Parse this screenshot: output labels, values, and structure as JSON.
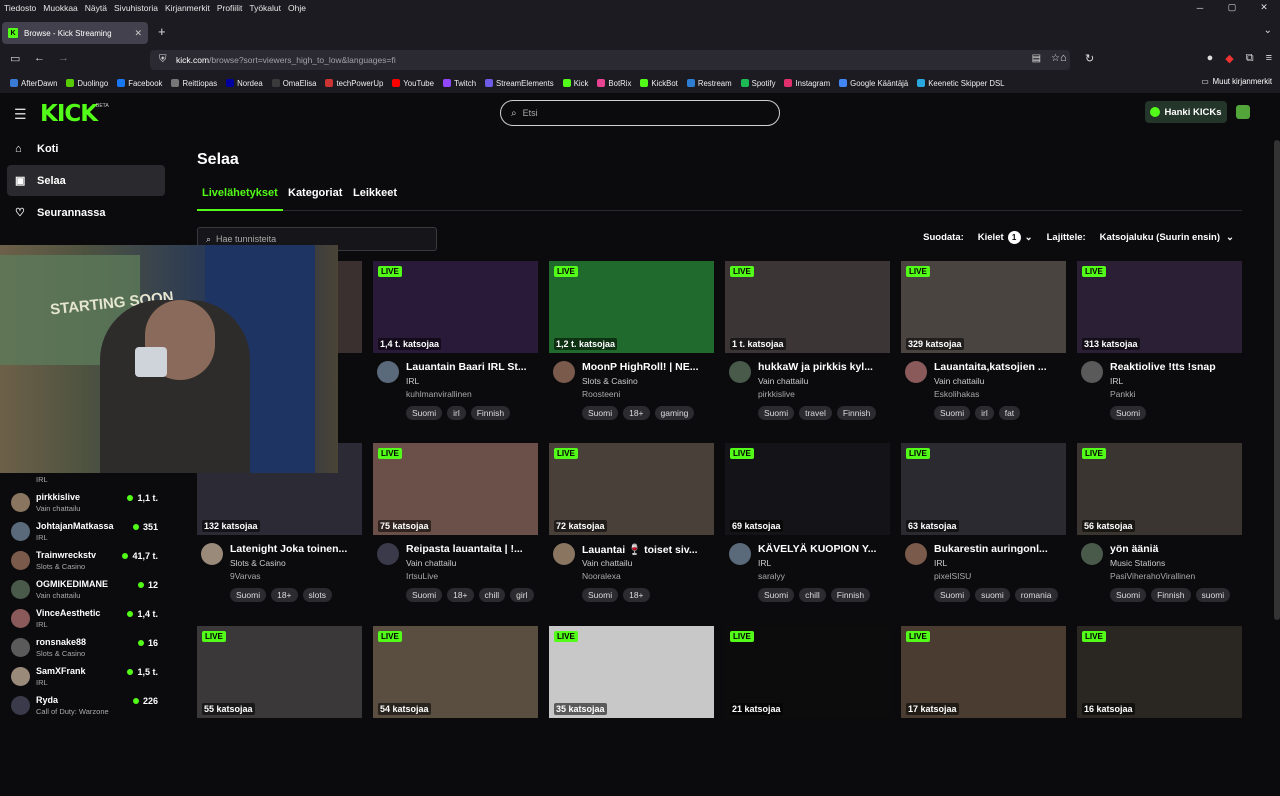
{
  "menubar": [
    "Tiedosto",
    "Muokkaa",
    "Näytä",
    "Sivuhistoria",
    "Kirjanmerkit",
    "Profiilit",
    "Työkalut",
    "Ohje"
  ],
  "browser": {
    "tab_title": "Browse - Kick Streaming",
    "url_domain": "kick.com",
    "url_path": "/browse?sort=viewers_high_to_low&languages=fi"
  },
  "bookmarks": [
    {
      "label": "AfterDawn",
      "color": "#3a7bd5"
    },
    {
      "label": "Duolingo",
      "color": "#58cc02"
    },
    {
      "label": "Facebook",
      "color": "#1877f2"
    },
    {
      "label": "Reittiopas",
      "color": "#777777"
    },
    {
      "label": "Nordea",
      "color": "#0000a0"
    },
    {
      "label": "OmaElisa",
      "color": "#3a3a3a"
    },
    {
      "label": "techPowerUp",
      "color": "#c33"
    },
    {
      "label": "YouTube",
      "color": "#ff0000"
    },
    {
      "label": "Twitch",
      "color": "#9146ff"
    },
    {
      "label": "StreamElements",
      "color": "#6c5ce7"
    },
    {
      "label": "Kick",
      "color": "#53fc18"
    },
    {
      "label": "BotRix",
      "color": "#e84393"
    },
    {
      "label": "KickBot",
      "color": "#53fc18"
    },
    {
      "label": "Restream",
      "color": "#2d7dd2"
    },
    {
      "label": "Spotify",
      "color": "#1db954"
    },
    {
      "label": "Instagram",
      "color": "#e1306c"
    },
    {
      "label": "Google Kääntäjä",
      "color": "#4285f4"
    },
    {
      "label": "Keenetic Skipper DSL",
      "color": "#2aa8e0"
    }
  ],
  "bookmarks_other": "Muut kirjanmerkit",
  "header": {
    "logo": "KICK",
    "beta": "BETA",
    "search_placeholder": "Etsi",
    "get_kicks": "Hanki KICKs"
  },
  "sidebar": {
    "nav": [
      {
        "label": "Koti",
        "icon": "home-icon"
      },
      {
        "label": "Selaa",
        "icon": "browse-icon"
      },
      {
        "label": "Seurannassa",
        "icon": "heart-icon"
      }
    ],
    "channels": [
      {
        "name": "",
        "category": "IRL",
        "viewers": ""
      },
      {
        "name": "pirkkislive",
        "category": "Vain chattailu",
        "viewers": "1,1 t."
      },
      {
        "name": "JohtajanMatkassa",
        "category": "IRL",
        "viewers": "351"
      },
      {
        "name": "Trainwreckstv",
        "category": "Slots & Casino",
        "viewers": "41,7 t."
      },
      {
        "name": "OGMIKEDIMANE",
        "category": "Vain chattailu",
        "viewers": "12"
      },
      {
        "name": "VinceAesthetic",
        "category": "IRL",
        "viewers": "1,4 t."
      },
      {
        "name": "ronsnake88",
        "category": "Slots & Casino",
        "viewers": "16"
      },
      {
        "name": "SamXFrank",
        "category": "IRL",
        "viewers": "1,5 t."
      },
      {
        "name": "Ryda",
        "category": "Call of Duty: Warzone",
        "viewers": "226"
      }
    ]
  },
  "main": {
    "title": "Selaa",
    "tabs": [
      "Livelähetykset",
      "Kategoriat",
      "Leikkeet"
    ],
    "tag_search_placeholder": "Hae tunnisteita",
    "filter_label": "Suodata:",
    "languages_label": "Kielet",
    "languages_count": "1",
    "sort_label": "Lajittele:",
    "sort_value": "Katsojaluku (Suurin ensin)",
    "live_badge": "LIVE"
  },
  "streams": [
    {
      "viewers": "",
      "title": "",
      "category": "",
      "user": "",
      "tags": [],
      "thumb": "#3a3030"
    },
    {
      "viewers": "1,4 t. katsojaa",
      "title": "Lauantain Baari IRL St...",
      "category": "IRL",
      "user": "kuhlmanvirallinen",
      "tags": [
        "Suomi",
        "irl",
        "Finnish"
      ],
      "thumb": "#2a1a3a"
    },
    {
      "viewers": "1,2 t. katsojaa",
      "title": "MoonP HighRoll! | NE...",
      "category": "Slots & Casino",
      "user": "Roosteeni",
      "tags": [
        "Suomi",
        "18+",
        "gaming"
      ],
      "thumb": "#1f6a2c"
    },
    {
      "viewers": "1 t. katsojaa",
      "title": "hukkaW ja pirkkis kyl...",
      "category": "Vain chattailu",
      "user": "pirkkislive",
      "tags": [
        "Suomi",
        "travel",
        "Finnish"
      ],
      "thumb": "#3b3535"
    },
    {
      "viewers": "329 katsojaa",
      "title": "Lauantaita,katsojien ...",
      "category": "Vain chattailu",
      "user": "Eskolihakas",
      "tags": [
        "Suomi",
        "irl",
        "fat"
      ],
      "thumb": "#4a4440"
    },
    {
      "viewers": "313 katsojaa",
      "title": "Reaktiolive !tts !snap",
      "category": "IRL",
      "user": "Pankki",
      "tags": [
        "Suomi"
      ],
      "thumb": "#2a1f35"
    },
    {
      "viewers": "132 katsojaa",
      "title": "Latenight Joka toinen...",
      "category": "Slots & Casino",
      "user": "9Varvas",
      "tags": [
        "Suomi",
        "18+",
        "slots"
      ],
      "thumb": "#2c2a35"
    },
    {
      "viewers": "75 katsojaa",
      "title": "Reipasta lauantaita | !...",
      "category": "Vain chattailu",
      "user": "IrtsuLive",
      "tags": [
        "Suomi",
        "18+",
        "chill",
        "girl"
      ],
      "thumb": "#6a5048"
    },
    {
      "viewers": "72 katsojaa",
      "title": "Lauantai 🍷 toiset siv...",
      "category": "Vain chattailu",
      "user": "Nooralexa",
      "tags": [
        "Suomi",
        "18+"
      ],
      "thumb": "#4a403a"
    },
    {
      "viewers": "69 katsojaa",
      "title": "KÄVELYÄ KUOPION Y...",
      "category": "IRL",
      "user": "saralyy",
      "tags": [
        "Suomi",
        "chill",
        "Finnish"
      ],
      "thumb": "#141418"
    },
    {
      "viewers": "63 katsojaa",
      "title": "Bukarestin auringonl...",
      "category": "IRL",
      "user": "pixelSISU",
      "tags": [
        "Suomi",
        "suomi",
        "romania"
      ],
      "thumb": "#2a2a30"
    },
    {
      "viewers": "56 katsojaa",
      "title": "yön ääniä",
      "category": "Music Stations",
      "user": "PasiViherahoVirallinen",
      "tags": [
        "Suomi",
        "Finnish",
        "suomi"
      ],
      "thumb": "#3a3530"
    },
    {
      "viewers": "55 katsojaa",
      "title": "",
      "category": "",
      "user": "",
      "tags": [],
      "thumb": "#3a3838"
    },
    {
      "viewers": "54 katsojaa",
      "title": "",
      "category": "",
      "user": "",
      "tags": [],
      "thumb": "#5a4e40"
    },
    {
      "viewers": "35 katsojaa",
      "title": "",
      "category": "",
      "user": "",
      "tags": [],
      "thumb": "#c8c8c8"
    },
    {
      "viewers": "21 katsojaa",
      "title": "",
      "category": "",
      "user": "",
      "tags": [],
      "thumb": "#0c0c0c"
    },
    {
      "viewers": "17 katsojaa",
      "title": "",
      "category": "",
      "user": "",
      "tags": [],
      "thumb": "#4a3c30"
    },
    {
      "viewers": "16 katsojaa",
      "title": "",
      "category": "",
      "user": "",
      "tags": [],
      "thumb": "#2a2622"
    }
  ],
  "webcam_poster_text": "STARTING SOON"
}
